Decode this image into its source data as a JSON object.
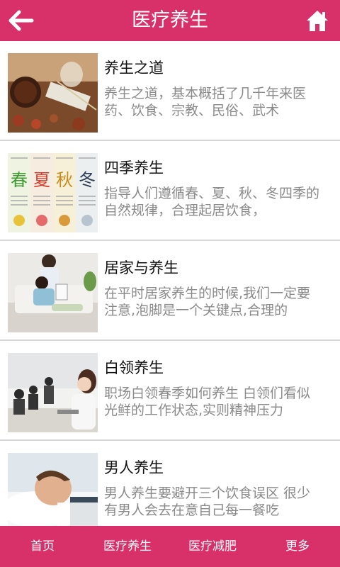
{
  "header": {
    "title": "医疗养生",
    "back_icon": "arrow-left-icon",
    "home_icon": "home-icon"
  },
  "articles": [
    {
      "title": "养生之道",
      "desc": "养生之道，基本概括了几千年来医药、饮食、宗教、民俗、武术",
      "thumb": "herbal-medicine-image"
    },
    {
      "title": "四季养生",
      "desc": "指导人们遵循春、夏、秋、冬四季的自然规律，合理起居饮食，",
      "thumb": "four-seasons-image",
      "thumb_text": [
        "春",
        "夏",
        "秋",
        "冬"
      ]
    },
    {
      "title": "居家与养生",
      "desc": "在平时居家养生的时候,我们一定要注意,泡脚是一个关键点,合理的",
      "thumb": "couple-at-home-image"
    },
    {
      "title": "白领养生",
      "desc": "职场白领春季如何养生 白领们看似光鲜的工作状态,实则精神压力",
      "thumb": "office-workers-image"
    },
    {
      "title": "男人养生",
      "desc": "男人养生要避开三个饮食误区 很少有男人会去在意自己每一餐吃",
      "thumb": "sleeping-man-image"
    }
  ],
  "footer": {
    "tabs": [
      "首页",
      "医疗养生",
      "医疗减肥",
      "更多"
    ]
  },
  "colors": {
    "brand": "#d8316a",
    "desc_text": "#8a8a8a"
  }
}
